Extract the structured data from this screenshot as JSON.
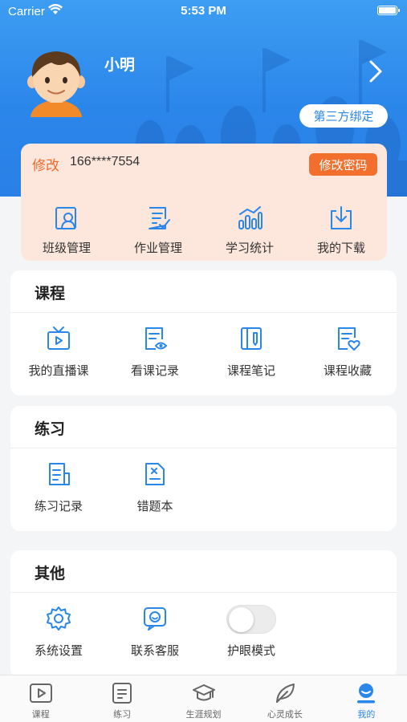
{
  "status_bar": {
    "carrier": "Carrier",
    "time": "5:53 PM"
  },
  "profile": {
    "name": "小明",
    "bind_label": "第三方绑定"
  },
  "account": {
    "modify_label": "修改",
    "phone": "166****7554",
    "change_password_label": "修改密码",
    "items": [
      {
        "label": "班级管理",
        "icon": "class-management-icon"
      },
      {
        "label": "作业管理",
        "icon": "homework-management-icon"
      },
      {
        "label": "学习统计",
        "icon": "study-statistics-icon"
      },
      {
        "label": "我的下载",
        "icon": "my-downloads-icon"
      }
    ]
  },
  "courses": {
    "title": "课程",
    "items": [
      {
        "label": "我的直播课",
        "icon": "live-class-icon"
      },
      {
        "label": "看课记录",
        "icon": "watch-history-icon"
      },
      {
        "label": "课程笔记",
        "icon": "course-notes-icon"
      },
      {
        "label": "课程收藏",
        "icon": "course-favorites-icon"
      }
    ]
  },
  "practice": {
    "title": "练习",
    "items": [
      {
        "label": "练习记录",
        "icon": "practice-record-icon"
      },
      {
        "label": "错题本",
        "icon": "mistake-book-icon"
      }
    ]
  },
  "other": {
    "title": "其他",
    "items": [
      {
        "label": "系统设置",
        "icon": "settings-icon"
      },
      {
        "label": "联系客服",
        "icon": "customer-service-icon"
      },
      {
        "label": "护眼模式",
        "icon": "eye-care-toggle"
      }
    ],
    "eye_care_on": false
  },
  "tabbar": {
    "items": [
      {
        "label": "课程",
        "icon": "course-tab-icon",
        "active": false
      },
      {
        "label": "练习",
        "icon": "practice-tab-icon",
        "active": false
      },
      {
        "label": "生涯规划",
        "icon": "career-tab-icon",
        "active": false
      },
      {
        "label": "心灵成长",
        "icon": "growth-tab-icon",
        "active": false
      },
      {
        "label": "我的",
        "icon": "profile-tab-icon",
        "active": true
      }
    ]
  },
  "colors": {
    "primary": "#2b86ea",
    "accent": "#f36f2d",
    "card_peach": "#fde7dc"
  }
}
